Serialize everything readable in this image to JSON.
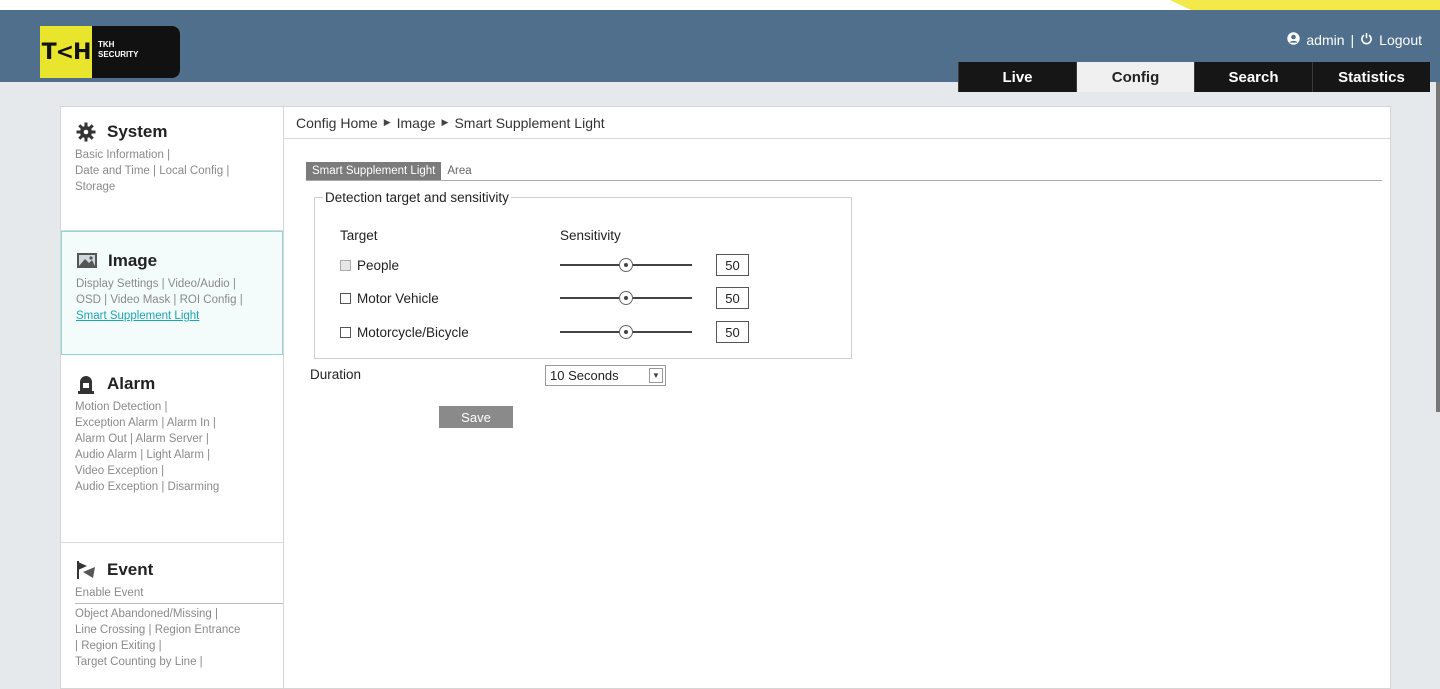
{
  "brand": {
    "logo_mark": "T<H",
    "logo_line1": "TKH",
    "logo_line2": "SECURITY"
  },
  "user_bar": {
    "user_icon": "user-icon",
    "username": "admin",
    "separator": "|",
    "logout_icon": "power-icon",
    "logout_label": "Logout"
  },
  "nav": {
    "tabs": [
      {
        "label": "Live",
        "active": false
      },
      {
        "label": "Config",
        "active": true
      },
      {
        "label": "Search",
        "active": false
      },
      {
        "label": "Statistics",
        "active": false
      }
    ]
  },
  "sidebar": {
    "system": {
      "icon": "gear-icon",
      "title": "System",
      "links": [
        "Basic Information",
        "Date and Time",
        "Local Config",
        "Storage"
      ]
    },
    "image": {
      "icon": "image-icon",
      "title": "Image",
      "links": [
        "Display Settings",
        "Video/Audio",
        "OSD",
        "Video Mask",
        "ROI Config",
        "Smart Supplement Light"
      ]
    },
    "alarm": {
      "icon": "alarm-icon",
      "title": "Alarm",
      "links": [
        "Motion Detection",
        "Exception Alarm",
        "Alarm In",
        "Alarm Out",
        "Alarm Server",
        "Audio Alarm",
        "Light Alarm",
        "Video Exception",
        "Audio Exception",
        "Disarming"
      ]
    },
    "event": {
      "icon": "event-icon",
      "title": "Event",
      "links": [
        "Enable Event",
        "Object Abandoned/Missing",
        "Line Crossing",
        "Region Entrance",
        "Region Exiting",
        "Target Counting by Line"
      ]
    }
  },
  "breadcrumb": {
    "items": [
      "Config Home",
      "Image",
      "Smart Supplement Light"
    ],
    "arrow": "▶"
  },
  "subtabs": {
    "items": [
      {
        "label": "Smart Supplement Light",
        "active": true
      },
      {
        "label": "Area",
        "active": false
      }
    ]
  },
  "detection": {
    "legend": "Detection target and sensitivity",
    "col_target": "Target",
    "col_sensitivity": "Sensitivity",
    "rows": [
      {
        "label": "People",
        "checked": false,
        "disabled": true,
        "value": "50",
        "level": 50
      },
      {
        "label": "Motor Vehicle",
        "checked": false,
        "disabled": false,
        "value": "50",
        "level": 50
      },
      {
        "label": "Motorcycle/Bicycle",
        "checked": false,
        "disabled": false,
        "value": "50",
        "level": 50
      }
    ]
  },
  "duration": {
    "label": "Duration",
    "value": "10 Seconds"
  },
  "save_label": "Save"
}
